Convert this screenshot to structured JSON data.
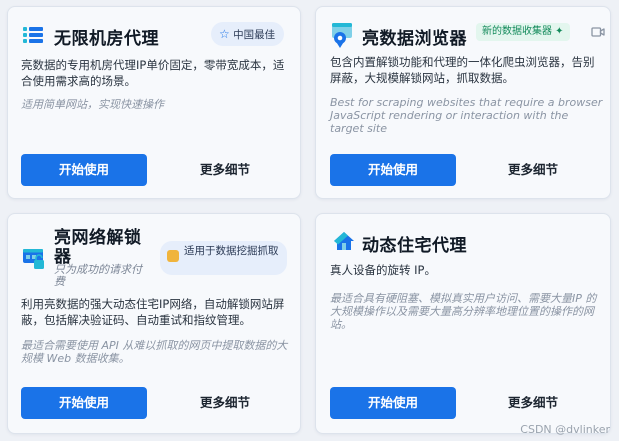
{
  "cards": [
    {
      "title": "无限机房代理",
      "badge": "中国最佳",
      "description": "亮数据的专用机房代理IP单价固定，零带宽成本，适合使用需求高的场景。",
      "note": "适用简单网站，实现快速操作",
      "primary_button": "开始使用",
      "secondary_button": "更多细节",
      "icon": "server-rack-icon"
    },
    {
      "title": "亮数据浏览器",
      "badge": "新的数据收集器 ✦",
      "description": "包含内置解锁功能和代理的一体化爬虫浏览器，告别屏蔽，大规模解锁网站，抓取数据。",
      "note": "Best for scraping websites that require a browser JavaScript rendering or interaction with the target site",
      "primary_button": "开始使用",
      "secondary_button": "更多细节",
      "icon": "browser-pin-icon",
      "extra_icon": "video-camera-icon"
    },
    {
      "title": "亮网络解锁器",
      "subtitle": "只为成功的请求付费",
      "badge": "适用于数据挖掘抓取",
      "description": "利用亮数据的强大动态住宅IP网络，自动解锁网站屏蔽，包括解决验证码、自动重试和指纹管理。",
      "note": "最适合需要使用 API 从难以抓取的网页中提取数据的大规模 Web 数据收集。",
      "primary_button": "开始使用",
      "secondary_button": "更多细节",
      "icon": "unlocker-icon",
      "badge_icon": "thumbs-up-icon"
    },
    {
      "title": "动态住宅代理",
      "description": "真人设备的旋转 IP。",
      "note": "最适合具有硬阻塞、模拟真实用户访问、需要大量IP 的大规模操作以及需要大量高分辨率地理位置的操作的网站。",
      "primary_button": "开始使用",
      "secondary_button": "更多细节",
      "icon": "house-icon"
    }
  ],
  "watermark": "CSDN @dvlinker",
  "colors": {
    "primary": "#1a73e8",
    "accent": "#23b8d6",
    "badge_bg": "#e6eefb",
    "badge_green_bg": "#e3f6ee",
    "badge_green_text": "#128a5a"
  }
}
